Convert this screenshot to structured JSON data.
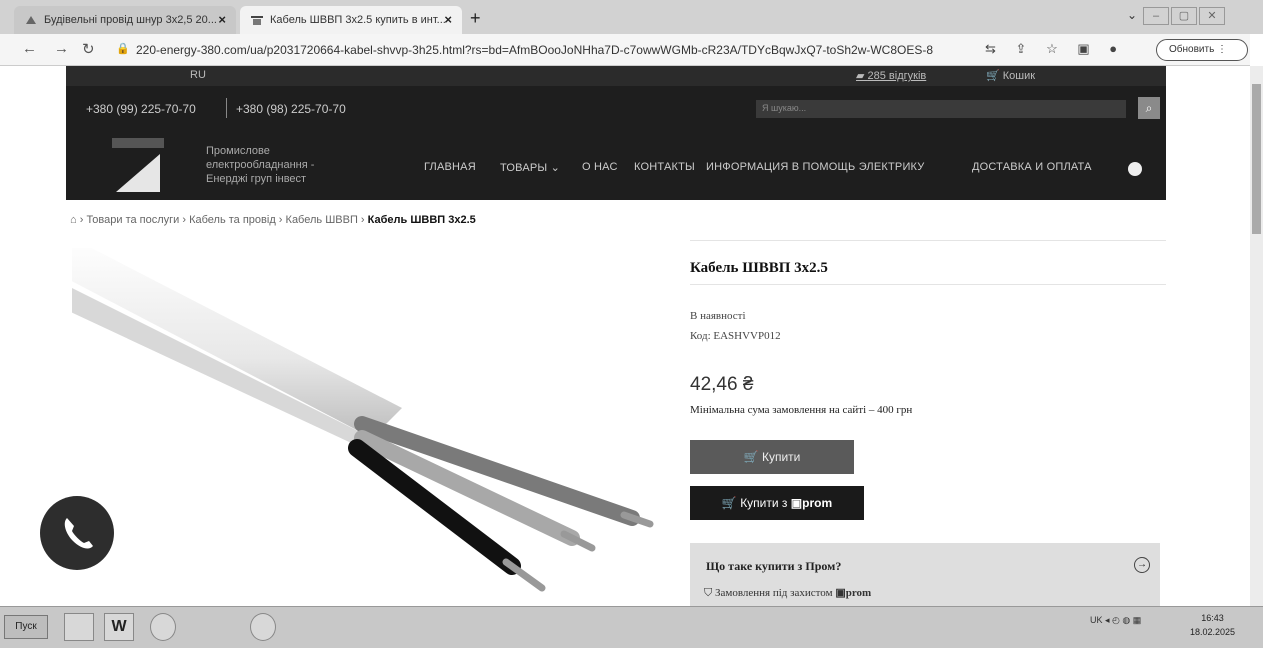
{
  "browser": {
    "tabs": [
      {
        "title": "Будівельні провід шнур 3х2,5 20..."
      },
      {
        "title": "Кабель ШВВП 3х2.5 купить в инт..."
      }
    ],
    "url": "220-energy-380.com/ua/p2031720664-kabel-shvvp-3h25.html?rs=bd=AfmBOooJoNHha7D-c7owwWGMb-cR23A/TDYcBqwJxQ7-toSh2w-WC8OES-8",
    "update_label": "Обновить"
  },
  "site": {
    "topbar": {
      "lang": "RU",
      "reviews": "285 відгуків",
      "cart": "Кошик"
    },
    "phones": [
      "+380 (99) 225-70-70",
      "+380 (98) 225-70-70"
    ],
    "search_placeholder": "Я шукаю...",
    "company_name": [
      "Промислове",
      "електрообладнання -",
      "Енерджі груп інвест"
    ],
    "nav": [
      {
        "label": "ГЛАВНАЯ"
      },
      {
        "label": "ТОВАРЫ"
      },
      {
        "label": "О НАС"
      },
      {
        "label": "КОНТАКТЫ"
      },
      {
        "label": "ИНФОРМАЦИЯ В ПОМОЩЬ ЭЛЕКТРИКУ"
      },
      {
        "label": "ДОСТАВКА И ОПЛАТА"
      }
    ],
    "breadcrumb": {
      "items": [
        "Товари та послуги",
        "Кабель та провід",
        "Кабель ШВВП"
      ],
      "current": "Кабель ШВВП 3х2.5"
    }
  },
  "product": {
    "title": "Кабель ШВВП 3х2.5",
    "availability": "В наявності",
    "code": "Код: EASHVVP012",
    "price": "42,46 ₴",
    "min_order": "Мінімальна сума замовлення на сайті – 400 грн",
    "buy_label": "Купити",
    "buy_prom_label": "Купити з",
    "prom_brand": "prom",
    "prom_question": "Що таке купити з Пром?",
    "prom_guarantee": "Замовлення під захистом"
  },
  "taskbar": {
    "start_label": "Пуск",
    "lang": "UK",
    "time": "16:43",
    "date": "18.02.2025"
  }
}
